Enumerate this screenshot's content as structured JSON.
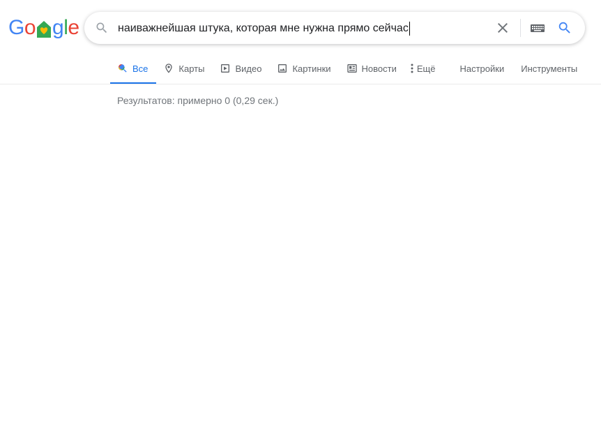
{
  "logo": {
    "letters": [
      "G",
      "o",
      "",
      "g",
      "l",
      "e"
    ],
    "alt": "Google",
    "colors": {
      "blue": "#4285f4",
      "red": "#ea4335",
      "yellow": "#fbbc05",
      "green": "#34a853"
    }
  },
  "search": {
    "query": "наиважнейшая штука, которая мне нужна прямо сейчас",
    "icons": {
      "left": "search-icon",
      "clear": "close-icon",
      "keyboard": "keyboard-icon",
      "submit": "search-icon"
    }
  },
  "tabs": [
    {
      "label": "Все",
      "icon": "search-icon",
      "active": true
    },
    {
      "label": "Карты",
      "icon": "map-pin-icon",
      "active": false
    },
    {
      "label": "Видео",
      "icon": "play-icon",
      "active": false
    },
    {
      "label": "Картинки",
      "icon": "image-icon",
      "active": false
    },
    {
      "label": "Новости",
      "icon": "news-icon",
      "active": false
    },
    {
      "label": "Ещё",
      "icon": "more-vert-icon",
      "active": false
    },
    {
      "label": "Настройки",
      "icon": "",
      "active": false
    },
    {
      "label": "Инструменты",
      "icon": "",
      "active": false
    }
  ],
  "results": {
    "stats": "Результатов: примерно 0 (0,29 сек.)"
  },
  "colors": {
    "accent": "#1a73e8",
    "tab_text": "#5f6368",
    "stats_text": "#70757a"
  }
}
